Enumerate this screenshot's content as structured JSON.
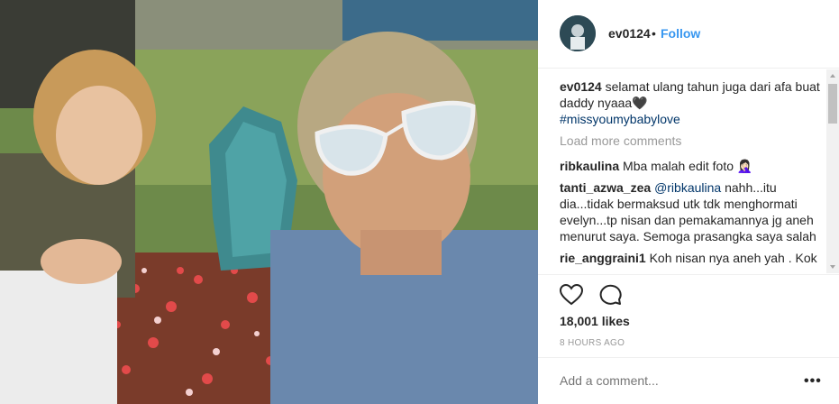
{
  "post": {
    "username": "ev0124",
    "separator": "•",
    "follow_label": "Follow",
    "caption_user": "ev0124",
    "caption_text": "selamat ulang tahun juga dari afa buat daddy nyaaa🖤",
    "caption_hashtag": "#missyoumybabylove",
    "load_more_label": "Load more comments",
    "comments": [
      {
        "user": "ribkaulina",
        "text": "Mba malah edit foto 🤦🏻‍♀️"
      },
      {
        "user": "tanti_azwa_zea",
        "mention": "@ribkaulina",
        "text": " nahh...itu dia...tidak bermaksud utk tdk menghormati evelyn...tp nisan dan pemakamannya jg aneh menurut saya. Semoga prasangka saya salah"
      },
      {
        "user": "rie_anggraini1",
        "text": "Koh nisan nya aneh yah . Kok ..."
      }
    ],
    "likes": "18,001 likes",
    "timestamp": "8 HOURS AGO",
    "add_comment_placeholder": "Add a comment...",
    "more_label": "•••"
  },
  "icons": {
    "like": "heart-icon",
    "comment": "comment-icon",
    "more": "more-options-icon"
  },
  "colors": {
    "follow_blue": "#3897f0",
    "hashtag_blue": "#003569",
    "muted_gray": "#999999"
  }
}
